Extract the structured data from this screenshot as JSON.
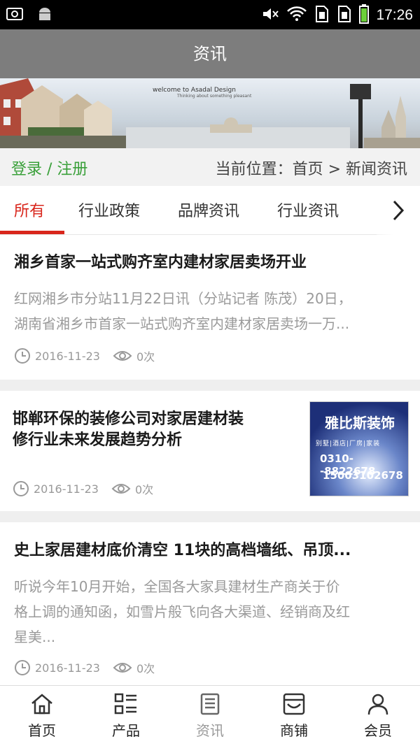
{
  "status_bar": {
    "time": "17:26"
  },
  "header": {
    "title": "资讯"
  },
  "banner": {
    "welcome": "welcome to Asadal Design",
    "tagline": "Thinking about something pleasant"
  },
  "breadcrumb": {
    "login": "登录 / 注册",
    "location": "当前位置：首页 > 新闻资讯"
  },
  "tabs": [
    {
      "label": "所有",
      "active": true
    },
    {
      "label": "行业政策",
      "active": false
    },
    {
      "label": "品牌资讯",
      "active": false
    },
    {
      "label": "行业资讯",
      "active": false
    }
  ],
  "articles": [
    {
      "title": "湘乡首家一站式购齐室内建材家居卖场开业",
      "summary_line1": "红网湘乡市分站11月22日讯（分站记者 陈茂）20日，",
      "summary_line2": "湖南省湘乡市首家一站式购齐室内建材家居卖场一万...",
      "date": "2016-11-23",
      "views": "0次"
    },
    {
      "title_line1": "邯郸环保的装修公司对家居建材装",
      "title_line2": "修行业未来发展趋势分析",
      "date": "2016-11-23",
      "views": "0次",
      "thumb": {
        "name": "雅比斯装饰",
        "categories": "别墅|酒店|厂房|家装",
        "phone1": "0310--8822678",
        "phone2": "15003102678"
      }
    },
    {
      "title": "史上家居建材底价清空 11块的高档墙纸、吊顶...",
      "summary_line1": "听说今年10月开始，全国各大家具建材生产商关于价",
      "summary_line2": "格上调的通知函，如雪片般飞向各大渠道、经销商及红",
      "summary_line3": "星美...",
      "date": "2016-11-23",
      "views": "0次"
    }
  ],
  "bottom_nav": [
    {
      "label": "首页",
      "icon": "home-icon"
    },
    {
      "label": "产品",
      "icon": "list-icon"
    },
    {
      "label": "资讯",
      "icon": "news-icon",
      "active": true
    },
    {
      "label": "商铺",
      "icon": "store-icon"
    },
    {
      "label": "会员",
      "icon": "user-icon"
    }
  ],
  "colors": {
    "accent": "#d9261c",
    "login": "#3aa03a",
    "title_bar": "#7d7d7d"
  }
}
